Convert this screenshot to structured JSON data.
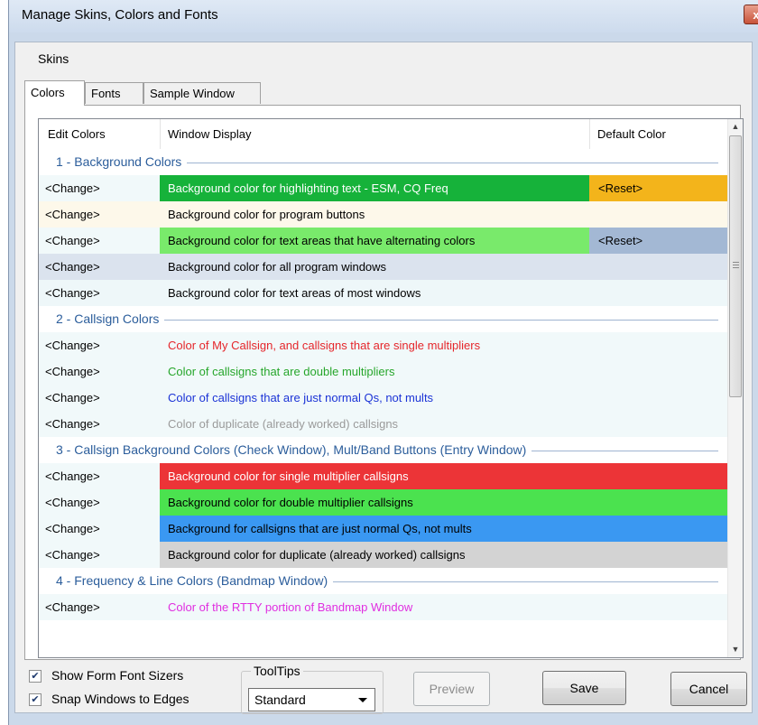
{
  "window": {
    "title": "Manage Skins, Colors and Fonts",
    "close_glyph": "x"
  },
  "menu": {
    "items": [
      "Skins"
    ]
  },
  "tabs": [
    "Colors",
    "Fonts",
    "Sample Window"
  ],
  "active_tab": "Colors",
  "grid": {
    "columns": [
      "Edit Colors",
      "Window Display",
      "Default Color"
    ],
    "sections": [
      {
        "title": "1 - Background Colors",
        "rows": [
          {
            "edit": "<Change>",
            "display": "Background color for highlighting text - ESM, CQ Freq",
            "default": "<Reset>",
            "display_bg": "#16b23a",
            "display_fg": "#ffffff",
            "default_bg": "#f3b41b"
          },
          {
            "edit": "<Change>",
            "display": "Background color for program buttons",
            "default": "",
            "display_bg": "#fdf8ea",
            "display_fg": "#000000",
            "default_bg": "#fdf8ea"
          },
          {
            "edit": "<Change>",
            "display": "Background color for text areas that have alternating colors",
            "default": "<Reset>",
            "display_bg": "#79ea6b",
            "display_fg": "#000000",
            "default_bg": "#a3b8d4"
          },
          {
            "edit": "<Change>",
            "display": "Background color for all program windows",
            "default": "",
            "display_bg": "#dbe3ee",
            "display_fg": "#000000",
            "default_bg": "#dbe3ee"
          },
          {
            "edit": "<Change>",
            "display": "Background color for text areas of most windows",
            "default": "",
            "display_bg": "#eef7f9",
            "display_fg": "#000000",
            "default_bg": "#eef7f9"
          }
        ]
      },
      {
        "title": "2 - Callsign Colors",
        "rows": [
          {
            "edit": "<Change>",
            "display": "Color of My Callsign, and callsigns that are single multipliers",
            "default": "",
            "display_bg": "#f1f9fa",
            "display_fg": "#e5262b",
            "default_bg": "#f1f9fa"
          },
          {
            "edit": "<Change>",
            "display": "Color of callsigns that are double multipliers",
            "default": "",
            "display_bg": "#f1f9fa",
            "display_fg": "#26a62b",
            "default_bg": "#f1f9fa"
          },
          {
            "edit": "<Change>",
            "display": "Color of callsigns that are just normal Qs, not mults",
            "default": "",
            "display_bg": "#f1f9fa",
            "display_fg": "#1b33d6",
            "default_bg": "#f1f9fa"
          },
          {
            "edit": "<Change>",
            "display": "Color of duplicate (already worked) callsigns",
            "default": "",
            "display_bg": "#f1f9fa",
            "display_fg": "#9a9a9a",
            "default_bg": "#f1f9fa"
          }
        ]
      },
      {
        "title": "3 - Callsign Background Colors (Check Window), Mult/Band Buttons (Entry Window)",
        "rows": [
          {
            "edit": "<Change>",
            "display": "Background color for single multiplier callsigns",
            "default": "",
            "display_bg": "#ec3437",
            "display_fg": "#ffffff",
            "default_bg": "#ec3437"
          },
          {
            "edit": "<Change>",
            "display": "Background color for double multiplier callsigns",
            "default": "",
            "display_bg": "#4be24f",
            "display_fg": "#000000",
            "default_bg": "#4be24f"
          },
          {
            "edit": "<Change>",
            "display": "Background for callsigns that are just normal Qs, not mults",
            "default": "",
            "display_bg": "#3a98f2",
            "display_fg": "#000000",
            "default_bg": "#3a98f2"
          },
          {
            "edit": "<Change>",
            "display": "Background color for duplicate (already worked) callsigns",
            "default": "",
            "display_bg": "#d3d3d3",
            "display_fg": "#000000",
            "default_bg": "#d3d3d3"
          }
        ]
      },
      {
        "title": "4 - Frequency & Line Colors (Bandmap Window)",
        "rows": [
          {
            "edit": "<Change>",
            "display": "Color of the RTTY portion of Bandmap Window",
            "default": "",
            "display_bg": "#f1f9fa",
            "display_fg": "#e02ee0",
            "default_bg": "#f1f9fa"
          }
        ]
      }
    ]
  },
  "options": {
    "show_form_font_sizers": {
      "label": "Show Form Font Sizers",
      "checked": true
    },
    "snap_windows": {
      "label": "Snap Windows to Edges",
      "checked": true
    },
    "tooltips": {
      "title": "ToolTips",
      "value": "Standard"
    }
  },
  "buttons": {
    "preview": "Preview",
    "save": "Save",
    "cancel": "Cancel"
  },
  "scroll_arrows": {
    "up": "▲",
    "down": "▼"
  }
}
